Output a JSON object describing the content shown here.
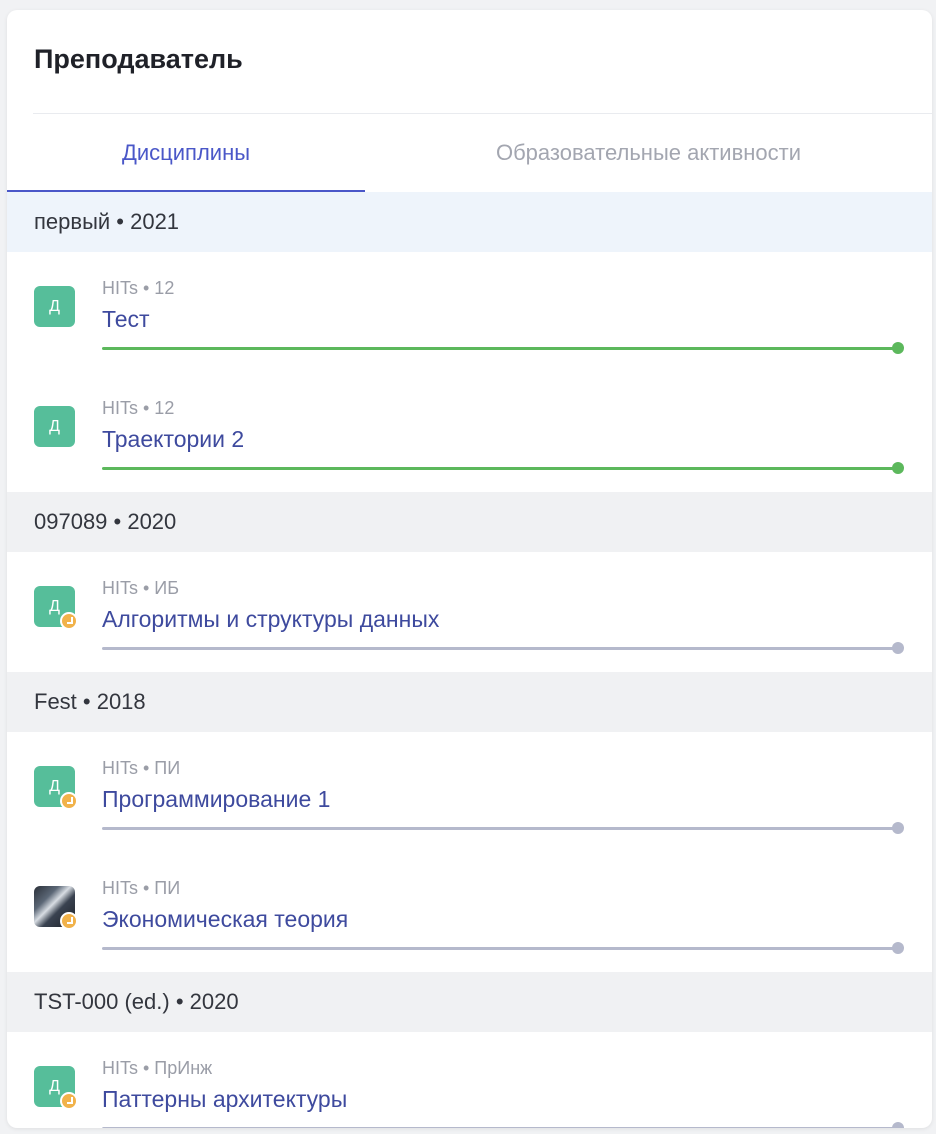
{
  "panel": {
    "title": "Преподаватель"
  },
  "tabs": [
    {
      "label": "Дисциплины",
      "active": true
    },
    {
      "label": "Образовательные активности",
      "active": false
    }
  ],
  "colors": {
    "accent": "#4a57c8",
    "complete": "#5cb85c",
    "incomplete": "#b5b9cc",
    "avatar": "#56be9a",
    "badge": "#f1b24a"
  },
  "sections": [
    {
      "header": "первый • 2021",
      "items": [
        {
          "meta": "HITs • 12",
          "name": "Тест",
          "avatar": "Д",
          "avatar_type": "letter",
          "badge": false,
          "progress": 1.0,
          "status": "complete"
        },
        {
          "meta": "HITs • 12",
          "name": "Траектории 2",
          "avatar": "Д",
          "avatar_type": "letter",
          "badge": false,
          "progress": 1.0,
          "status": "complete"
        }
      ]
    },
    {
      "header": "097089 • 2020",
      "items": [
        {
          "meta": "HITs • ИБ",
          "name": "Алгоритмы и структуры данных",
          "avatar": "Д",
          "avatar_type": "letter",
          "badge": true,
          "progress": 1.0,
          "status": "incomplete"
        }
      ]
    },
    {
      "header": "Fest • 2018",
      "items": [
        {
          "meta": "HITs • ПИ",
          "name": "Программирование 1",
          "avatar": "Д",
          "avatar_type": "letter",
          "badge": true,
          "progress": 1.0,
          "status": "incomplete"
        },
        {
          "meta": "HITs • ПИ",
          "name": "Экономическая теория",
          "avatar": "",
          "avatar_type": "photo",
          "badge": true,
          "progress": 1.0,
          "status": "incomplete"
        }
      ]
    },
    {
      "header": "TST-000 (ed.) • 2020",
      "items": [
        {
          "meta": "HITs • ПрИнж",
          "name": "Паттерны архитектуры",
          "avatar": "Д",
          "avatar_type": "letter",
          "badge": true,
          "progress": 1.0,
          "status": "incomplete"
        }
      ]
    }
  ]
}
